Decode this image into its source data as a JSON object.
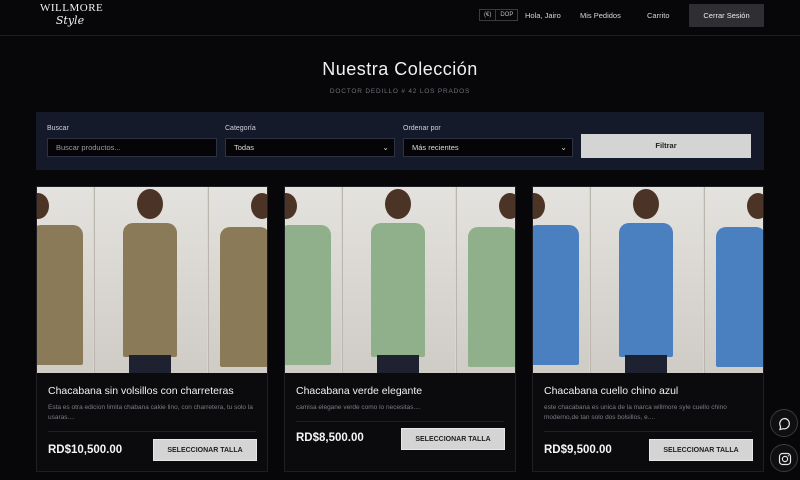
{
  "header": {
    "logo_line1": "WILLMORE",
    "logo_line2": "Style",
    "lang": [
      "(€)",
      "DOP"
    ],
    "greeting": "Hola, Jairo",
    "orders": "Mis Pedidos",
    "cart": "Carrito",
    "logout": "Cerrar Sesión"
  },
  "main": {
    "title": "Nuestra Colección",
    "subtitle": "DOCTOR DEDILLO # 42 LOS PRADOS"
  },
  "filters": {
    "search_label": "Buscar",
    "search_placeholder": "Buscar productos...",
    "category_label": "Categoría",
    "category_value": "Todas",
    "sort_label": "Ordenar por",
    "sort_value": "Más recientes",
    "filter_button": "Filtrar"
  },
  "products": [
    {
      "name": "Chacabana sin volsillos con charreteras",
      "desc": "Esta es otra edicion limita chabana cakie lino, con charretera, tu solo la usaras....",
      "price": "RD$10,500.00",
      "button": "SELECCIONAR TALLA",
      "shirt_color": "#8b7a57"
    },
    {
      "name": "Chacabana verde elegante",
      "desc": "camisa elegane verde como lo necesitas....",
      "price": "RD$8,500.00",
      "button": "SELECCIONAR TALLA",
      "shirt_color": "#8fb08a"
    },
    {
      "name": "Chacabana cuello chino azul",
      "desc": "este chacabana es unica de la marca willmore syle cuello chino moderno,de tan solo dos bolsillos, e....",
      "price": "RD$9,500.00",
      "button": "SELECCIONAR TALLA",
      "shirt_color": "#4a7fc0"
    }
  ],
  "social": [
    "chat-icon",
    "instagram-icon"
  ]
}
